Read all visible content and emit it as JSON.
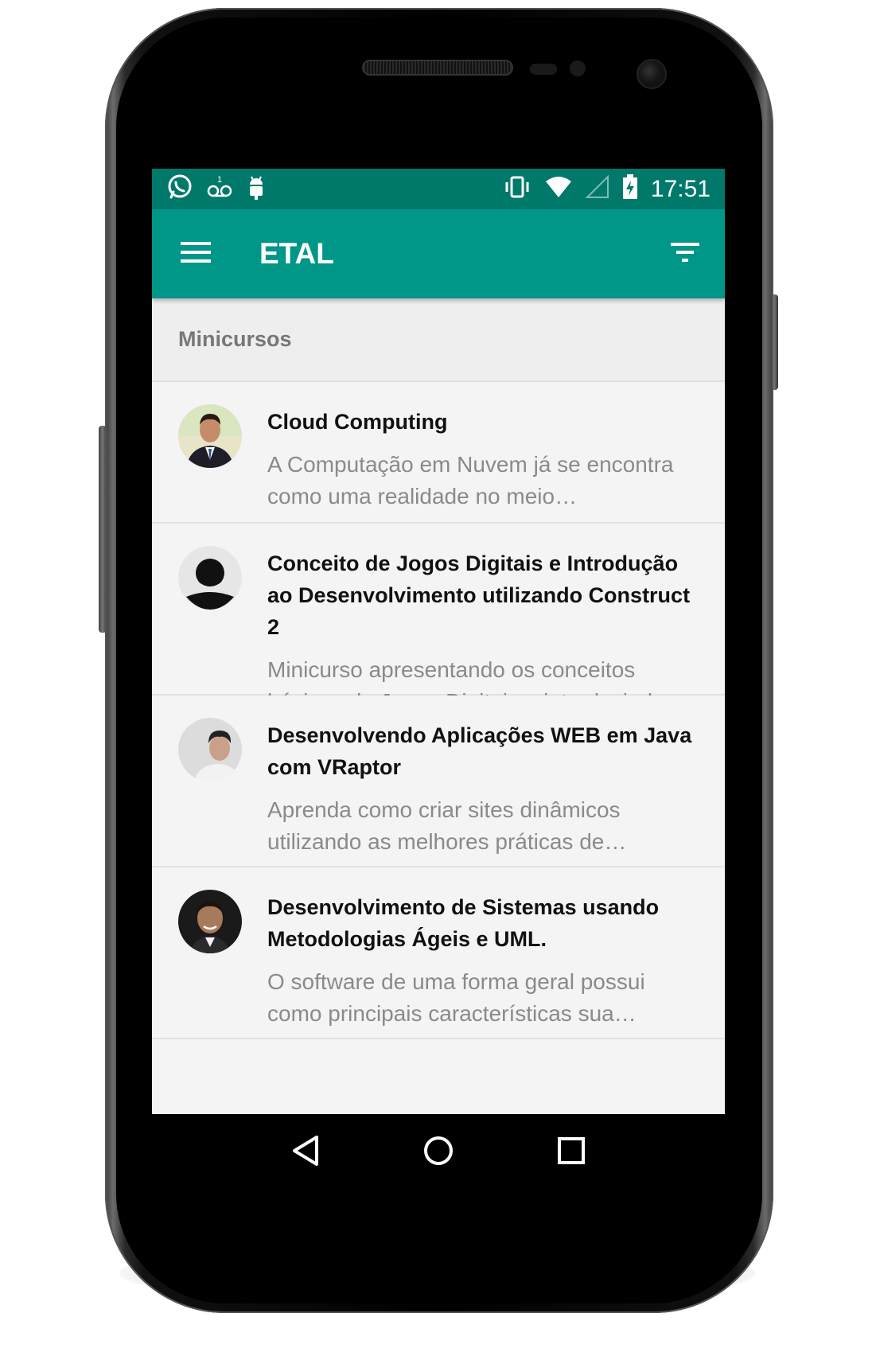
{
  "status_bar": {
    "time": "17:51",
    "left_icons": [
      "whatsapp-icon",
      "voicemail-icon",
      "android-debug-icon"
    ],
    "right_icons": [
      "vibrate-icon",
      "wifi-icon",
      "signal-icon",
      "battery-charging-icon"
    ]
  },
  "app_bar": {
    "title": "ETAL",
    "menu_icon": "hamburger-menu-icon",
    "filter_icon": "filter-icon"
  },
  "section": {
    "title": "Minicursos"
  },
  "courses": [
    {
      "title": "Cloud Computing",
      "description": "A Computação em Nuvem já se encontra como uma realidade no meio…",
      "avatar": "speaker-photo-1"
    },
    {
      "title": "Conceito de Jogos Digitais e Introdução ao Desenvolvimento utilizando Construct 2",
      "description": "Minicurso apresentando os conceitos básicos de Jogos Digitais e introduzindo a…",
      "avatar": "placeholder-avatar"
    },
    {
      "title": "Desenvolvendo Aplicações WEB em Java com VRaptor",
      "description": "Aprenda como criar sites dinâmicos utilizando as melhores práticas de…",
      "avatar": "speaker-photo-3"
    },
    {
      "title": "Desenvolvimento de Sistemas usando Metodologias Ágeis e UML.",
      "description": "O software de uma forma geral possui como principais características sua…",
      "avatar": "speaker-photo-4"
    }
  ],
  "nav_bar": {
    "buttons": [
      "back-icon",
      "home-icon",
      "recents-icon"
    ]
  },
  "colors": {
    "status_bar": "#00796b",
    "app_bar": "#009688",
    "background": "#f4f4f4",
    "section_header": "#eeeeee"
  }
}
